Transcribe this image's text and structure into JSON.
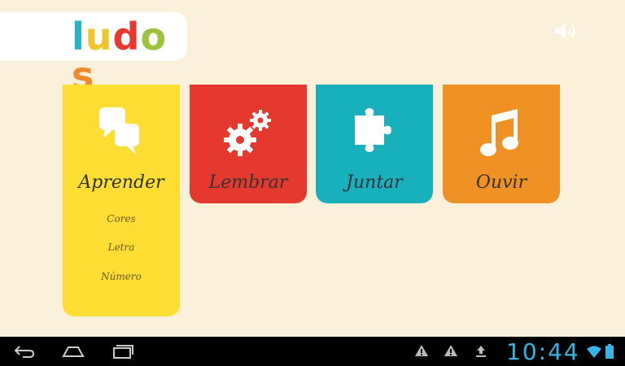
{
  "app": {
    "logo_letters": [
      {
        "char": "l",
        "color": "#1fb5c2"
      },
      {
        "char": "u",
        "color": "#f0c52a"
      },
      {
        "char": "d",
        "color": "#e8382d"
      },
      {
        "char": "o",
        "color": "#9bc43c"
      },
      {
        "char": "s",
        "color": "#f0892a"
      }
    ]
  },
  "sound": {
    "icon": "speaker-icon"
  },
  "menu": {
    "cards": [
      {
        "label": "Aprender",
        "icon": "speech-bubbles-icon",
        "color": "#ffde33",
        "subitems": [
          "Cores",
          "Letra",
          "Número"
        ]
      },
      {
        "label": "Lembrar",
        "icon": "gears-icon",
        "color": "#e5392f",
        "subitems": []
      },
      {
        "label": "Juntar",
        "icon": "puzzle-piece-icon",
        "color": "#19b0be",
        "subitems": []
      },
      {
        "label": "Ouvir",
        "icon": "music-note-icon",
        "color": "#ef9123",
        "subitems": []
      }
    ]
  },
  "system_bar": {
    "clock": "10:44",
    "buttons": [
      "back-icon",
      "home-icon",
      "recent-apps-icon"
    ],
    "notifications": [
      "warning-icon",
      "warning-icon",
      "upload-icon"
    ],
    "status_icons": [
      "wifi-icon",
      "battery-icon"
    ],
    "accent": "#33b5e5"
  }
}
